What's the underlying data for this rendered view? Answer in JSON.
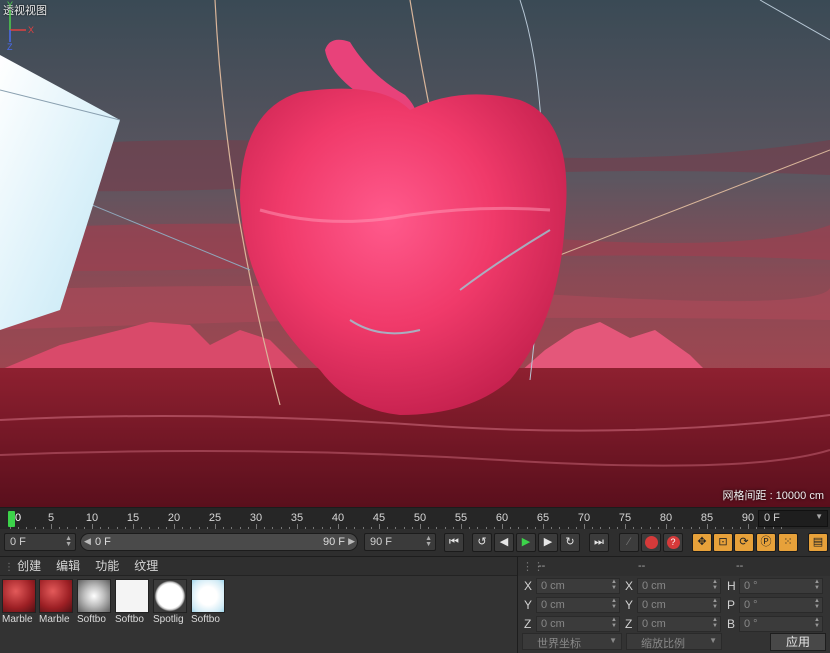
{
  "viewport": {
    "title": "透视视图",
    "grid_spacing": "网格间距 : 10000 cm",
    "axis": {
      "y": "Y",
      "x": "X",
      "z": "Z"
    }
  },
  "timeline": {
    "ticks": [
      "0",
      "5",
      "10",
      "15",
      "20",
      "25",
      "30",
      "35",
      "40",
      "45",
      "50",
      "55",
      "60",
      "65",
      "70",
      "75",
      "80",
      "85",
      "90"
    ],
    "current_frame_label": "0",
    "frame_display": "0 F"
  },
  "transport": {
    "start_frame": "0 F",
    "range_start": "0 F",
    "range_end": "90 F",
    "end_frame": "90 F",
    "buttons": [
      {
        "name": "go-to-start-button",
        "glyph": "⏮"
      },
      {
        "name": "prev-key-button",
        "glyph": "↺"
      },
      {
        "name": "prev-frame-button",
        "glyph": "◀"
      },
      {
        "name": "play-button",
        "glyph": "▶"
      },
      {
        "name": "next-frame-button",
        "glyph": "▶"
      },
      {
        "name": "next-key-button",
        "glyph": "↻"
      },
      {
        "name": "go-to-end-button",
        "glyph": "⏭"
      }
    ]
  },
  "materials": {
    "menu": [
      "创建",
      "编辑",
      "功能",
      "纹理"
    ],
    "items": [
      {
        "name": "Marble",
        "type": "marble"
      },
      {
        "name": "Marble",
        "type": "marble"
      },
      {
        "name": "Softbo",
        "type": "softbox-soft"
      },
      {
        "name": "Softbo",
        "type": "softbox"
      },
      {
        "name": "Spotlig",
        "type": "spotlight"
      },
      {
        "name": "Softbo",
        "type": "softbox-blue"
      }
    ]
  },
  "coordinates": {
    "header": [
      "--",
      "--",
      "--"
    ],
    "rows": [
      {
        "a_label": "X",
        "a_value": "0 cm",
        "b_label": "X",
        "b_value": "0 cm",
        "c_label": "H",
        "c_value": "0 °"
      },
      {
        "a_label": "Y",
        "a_value": "0 cm",
        "b_label": "Y",
        "b_value": "0 cm",
        "c_label": "P",
        "c_value": "0 °"
      },
      {
        "a_label": "Z",
        "a_value": "0 cm",
        "b_label": "Z",
        "b_value": "0 cm",
        "c_label": "B",
        "c_value": "0 °"
      }
    ],
    "world_coords": "世界坐标",
    "scale_ratio": "缩放比例",
    "apply": "应用"
  },
  "colors": {
    "playhead": "#3cd34a",
    "accent_orange": "#e7a13a",
    "record_red": "#d63a3a"
  }
}
